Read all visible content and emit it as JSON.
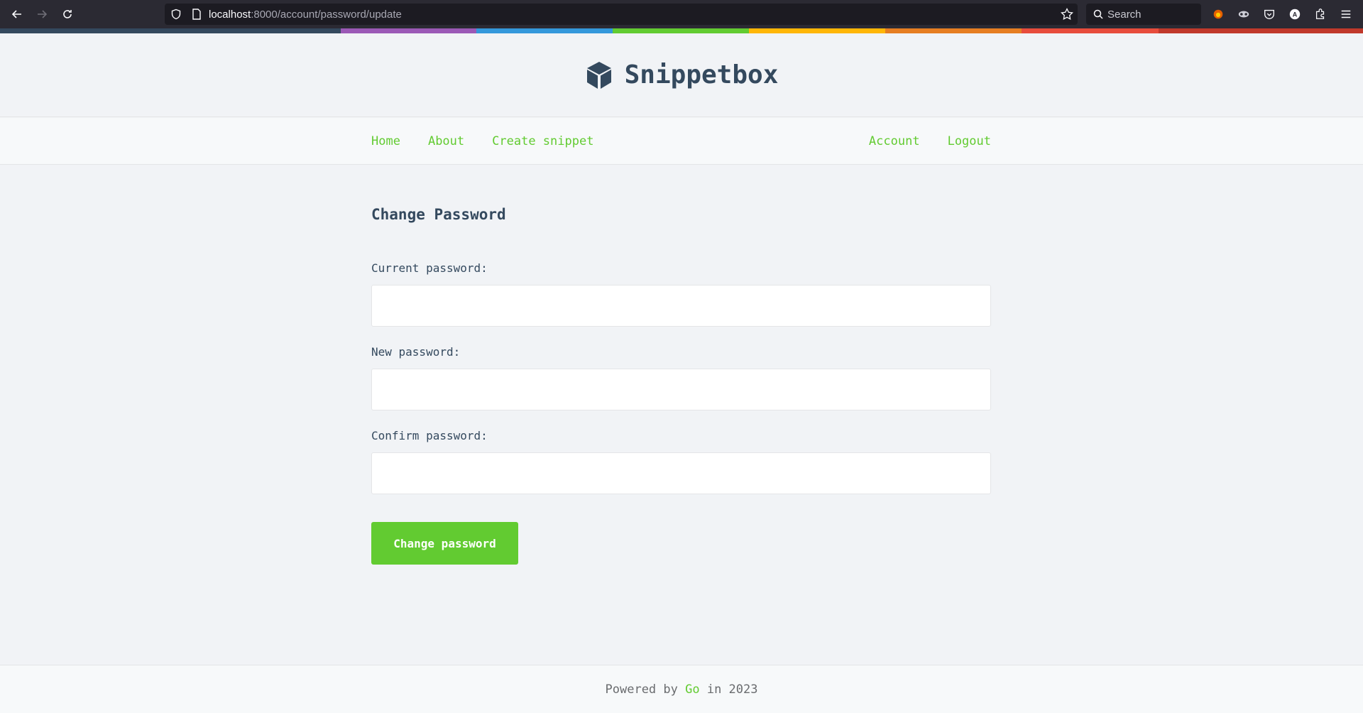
{
  "browser": {
    "url_host": "localhost",
    "url_path": ":8000/account/password/update",
    "search_placeholder": "Search",
    "colors": {
      "chrome": "#2b2a33",
      "field": "#1c1b22"
    }
  },
  "rainbow_colors": [
    "#34495e",
    "#9b59b6",
    "#3498db",
    "#62cb31",
    "#ffb606",
    "#e67e22",
    "#e74c3c",
    "#c0392b"
  ],
  "header": {
    "title": "Snippetbox",
    "logo_icon": "cube-icon"
  },
  "nav": {
    "left": [
      {
        "label": "Home"
      },
      {
        "label": "About"
      },
      {
        "label": "Create snippet"
      }
    ],
    "right": [
      {
        "label": "Account"
      },
      {
        "label": "Logout"
      }
    ]
  },
  "form": {
    "title": "Change Password",
    "current_label": "Current password:",
    "current_value": "",
    "new_label": "New password:",
    "new_value": "",
    "confirm_label": "Confirm password:",
    "confirm_value": "",
    "submit_label": "Change password"
  },
  "footer": {
    "prefix": "Powered by ",
    "link": "Go",
    "suffix": " in 2023"
  },
  "colors": {
    "accent": "#62cb31",
    "text": "#34495e",
    "background": "#f1f3f6"
  }
}
